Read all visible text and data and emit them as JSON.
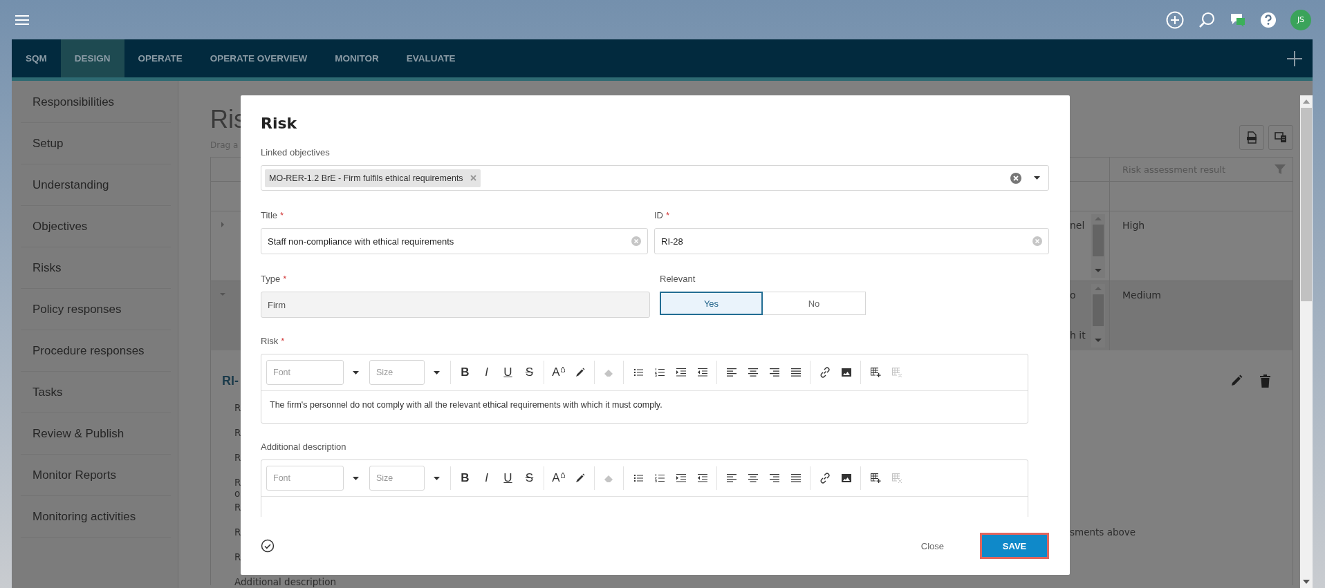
{
  "top_bar": {
    "avatar": "JS"
  },
  "nav": {
    "tabs": [
      {
        "label": "SQM",
        "selected": false
      },
      {
        "label": "DESIGN",
        "selected": true
      },
      {
        "label": "OPERATE",
        "selected": false
      },
      {
        "label": "OPERATE OVERVIEW",
        "selected": false
      },
      {
        "label": "MONITOR",
        "selected": false
      },
      {
        "label": "EVALUATE",
        "selected": false
      }
    ]
  },
  "sidebar": {
    "items": [
      {
        "label": "Responsibilities"
      },
      {
        "label": "Setup"
      },
      {
        "label": "Understanding"
      },
      {
        "label": "Objectives"
      },
      {
        "label": "Risks"
      },
      {
        "label": "Policy responses"
      },
      {
        "label": "Procedure responses"
      },
      {
        "label": "Tasks"
      },
      {
        "label": "Review & Publish"
      },
      {
        "label": "Monitor Reports"
      },
      {
        "label": "Monitoring activities"
      }
    ]
  },
  "page": {
    "title": "Ris",
    "subtitle": "Drag a",
    "table": {
      "columns": [
        {
          "label": "Risk assessment result"
        }
      ],
      "rows": [
        {
          "expanded": false,
          "column_2": [
            "nel"
          ],
          "result": "High"
        },
        {
          "expanded": true,
          "column_2": [
            "o",
            "h it"
          ],
          "result": "Medium"
        }
      ]
    },
    "detail": {
      "heading": "RI-",
      "lines": [
        {
          "lines": [
            "R"
          ]
        },
        {
          "lines": [
            "R"
          ]
        },
        {
          "lines": [
            "R"
          ]
        },
        {
          "lines": [
            "R",
            "o"
          ]
        },
        {
          "lines": [
            "R"
          ]
        },
        {
          "lines": [
            "R"
          ],
          "right": "sments above"
        },
        {
          "lines": [
            "R"
          ]
        },
        {
          "lines": [
            "Additional description"
          ]
        }
      ]
    }
  },
  "modal": {
    "title": "Risk",
    "linked_objectives": {
      "label": "Linked objectives",
      "chips": [
        {
          "label": "MO-RER-1.2 BrE - Firm fulfils ethical requirements"
        }
      ]
    },
    "title_field": {
      "label": "Title",
      "required_mark": "*",
      "value": "Staff non-compliance with ethical requirements"
    },
    "id_field": {
      "label": "ID",
      "required_mark": "*",
      "value": "RI-28"
    },
    "type_field": {
      "label": "Type",
      "required_mark": "*",
      "value": "Firm",
      "disabled": true
    },
    "relevant": {
      "label": "Relevant",
      "options": [
        {
          "label": "Yes",
          "selected": true
        },
        {
          "label": "No",
          "selected": false
        }
      ]
    },
    "editors": [
      {
        "label": "Risk",
        "required_mark": "*",
        "font_placeholder": "Font",
        "size_placeholder": "Size",
        "content": "The firm's personnel do not comply with all the relevant ethical requirements with which it must comply.",
        "toolbar": [
          [
            {
              "kind": "text",
              "label": "B",
              "disabled": false
            },
            {
              "kind": "text",
              "label": "I",
              "disabled": false
            },
            {
              "kind": "text",
              "label": "U",
              "disabled": false
            },
            {
              "kind": "text",
              "label": "S",
              "disabled": false
            }
          ],
          [
            {
              "kind": "text",
              "label": "A",
              "disabled": false
            },
            {
              "kind": "icon",
              "disabled": false
            }
          ],
          [
            {
              "kind": "icon",
              "disabled": true
            }
          ],
          [
            {
              "kind": "icon",
              "disabled": false
            },
            {
              "kind": "icon",
              "disabled": false
            },
            {
              "kind": "icon",
              "disabled": false
            },
            {
              "kind": "icon",
              "disabled": false
            }
          ],
          [
            {
              "kind": "icon",
              "disabled": false
            },
            {
              "kind": "icon",
              "disabled": false
            },
            {
              "kind": "icon",
              "disabled": false
            },
            {
              "kind": "icon",
              "disabled": false
            }
          ],
          [
            {
              "kind": "icon",
              "disabled": false
            },
            {
              "kind": "icon",
              "disabled": false
            }
          ],
          [
            {
              "kind": "icon",
              "disabled": false
            },
            {
              "kind": "icon",
              "disabled": true
            }
          ]
        ]
      },
      {
        "label": "Additional description",
        "font_placeholder": "Font",
        "size_placeholder": "Size",
        "toolbar": [
          [
            {
              "kind": "text",
              "label": "B",
              "disabled": false
            },
            {
              "kind": "text",
              "label": "I",
              "disabled": false
            },
            {
              "kind": "text",
              "label": "U",
              "disabled": false
            },
            {
              "kind": "text",
              "label": "S",
              "disabled": false
            }
          ],
          [
            {
              "kind": "text",
              "label": "A",
              "disabled": false
            },
            {
              "kind": "icon",
              "disabled": false
            }
          ],
          [
            {
              "kind": "icon",
              "disabled": true
            }
          ],
          [
            {
              "kind": "icon",
              "disabled": false
            },
            {
              "kind": "icon",
              "disabled": false
            },
            {
              "kind": "icon",
              "disabled": false
            },
            {
              "kind": "icon",
              "disabled": false
            }
          ],
          [
            {
              "kind": "icon",
              "disabled": false
            },
            {
              "kind": "icon",
              "disabled": false
            },
            {
              "kind": "icon",
              "disabled": false
            },
            {
              "kind": "icon",
              "disabled": false
            }
          ],
          [
            {
              "kind": "icon",
              "disabled": false
            },
            {
              "kind": "icon",
              "disabled": false
            }
          ],
          [
            {
              "kind": "icon",
              "disabled": false
            },
            {
              "kind": "icon",
              "disabled": true
            }
          ]
        ]
      }
    ],
    "footer": {
      "close": "Close",
      "save": "SAVE"
    }
  }
}
